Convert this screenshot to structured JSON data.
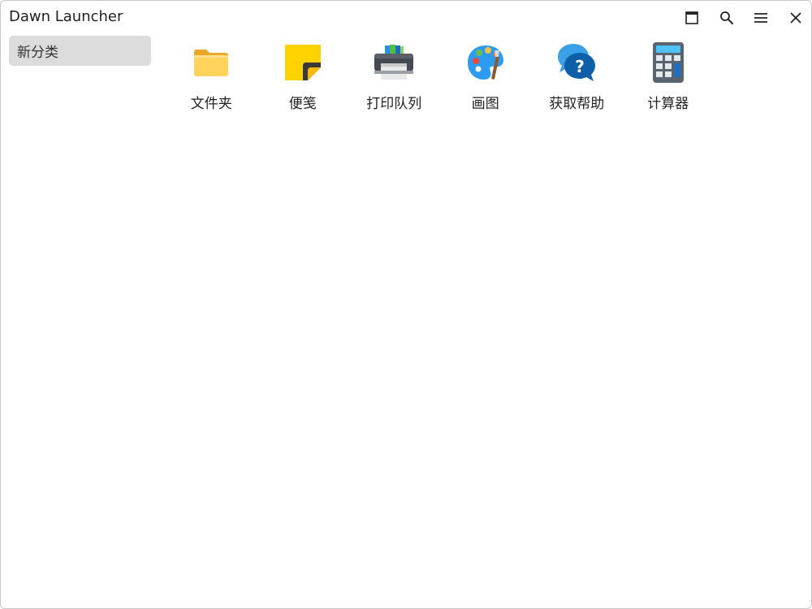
{
  "window": {
    "title": "Dawn Launcher",
    "controls": [
      {
        "name": "maximize",
        "icon": "maximize-icon"
      },
      {
        "name": "search",
        "icon": "search-icon"
      },
      {
        "name": "menu",
        "icon": "menu-icon"
      },
      {
        "name": "close",
        "icon": "close-icon"
      }
    ]
  },
  "sidebar": {
    "categories": [
      {
        "label": "新分类",
        "selected": true
      }
    ]
  },
  "items": [
    {
      "label": "文件夹",
      "icon": "folder-icon"
    },
    {
      "label": "便笺",
      "icon": "sticky-note-icon"
    },
    {
      "label": "打印队列",
      "icon": "printer-icon"
    },
    {
      "label": "画图",
      "icon": "paint-palette-icon"
    },
    {
      "label": "获取帮助",
      "icon": "help-chat-icon"
    },
    {
      "label": "计算器",
      "icon": "calculator-icon"
    }
  ],
  "colors": {
    "selected_category_bg": "#dcdcdc",
    "window_border": "#c8c8c8",
    "text": "#222222"
  }
}
